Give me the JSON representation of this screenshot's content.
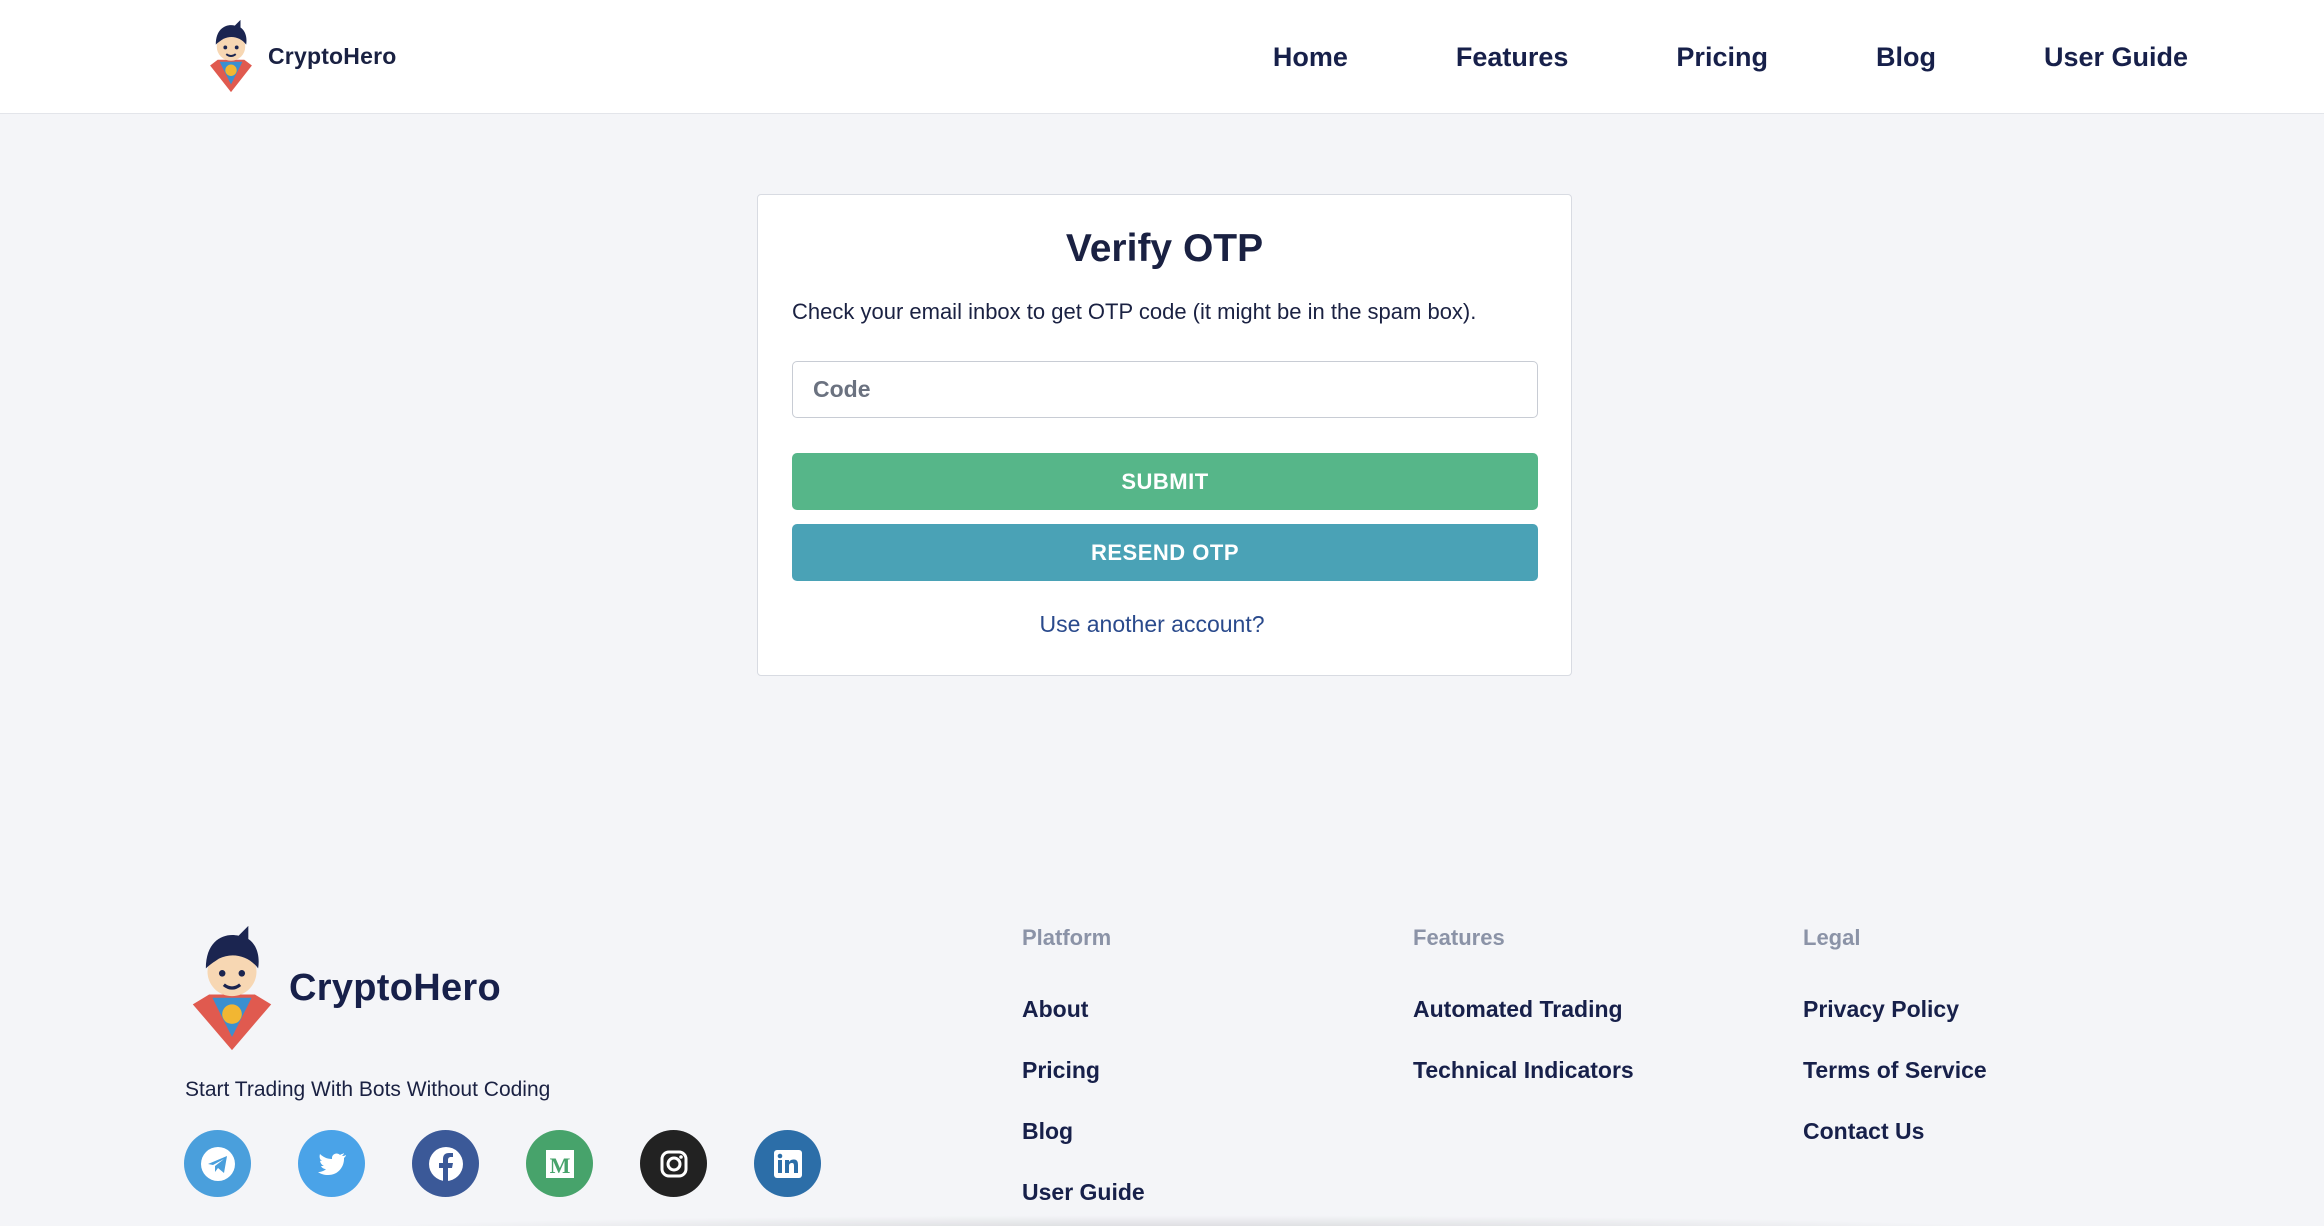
{
  "header": {
    "brand": "CryptoHero",
    "nav": [
      "Home",
      "Features",
      "Pricing",
      "Blog",
      "User Guide"
    ]
  },
  "card": {
    "title": "Verify OTP",
    "description": "Check your email inbox to get OTP code (it might be in the spam box).",
    "code_placeholder": "Code",
    "code_value": "",
    "submit_label": "SUBMIT",
    "resend_label": "RESEND OTP",
    "alt_link": "Use another account?"
  },
  "footer": {
    "brand": "CryptoHero",
    "tagline": "Start Trading With Bots Without Coding",
    "socials": [
      {
        "name": "telegram-icon",
        "color": "#4a9fdc"
      },
      {
        "name": "twitter-icon",
        "color": "#4aa3e8"
      },
      {
        "name": "facebook-icon",
        "color": "#3b5998"
      },
      {
        "name": "medium-icon",
        "color": "#47a36b"
      },
      {
        "name": "instagram-icon",
        "color": "#222222"
      },
      {
        "name": "linkedin-icon",
        "color": "#2c6ea8"
      }
    ],
    "columns": [
      {
        "heading": "Platform",
        "links": [
          "About",
          "Pricing",
          "Blog",
          "User Guide"
        ]
      },
      {
        "heading": "Features",
        "links": [
          "Automated Trading",
          "Technical Indicators"
        ]
      },
      {
        "heading": "Legal",
        "links": [
          "Privacy Policy",
          "Terms of Service",
          "Contact Us"
        ]
      }
    ]
  },
  "colors": {
    "submit": "#56b689",
    "resend": "#4aa2b6",
    "background": "#f4f5f8",
    "text_dark": "#17204a"
  }
}
